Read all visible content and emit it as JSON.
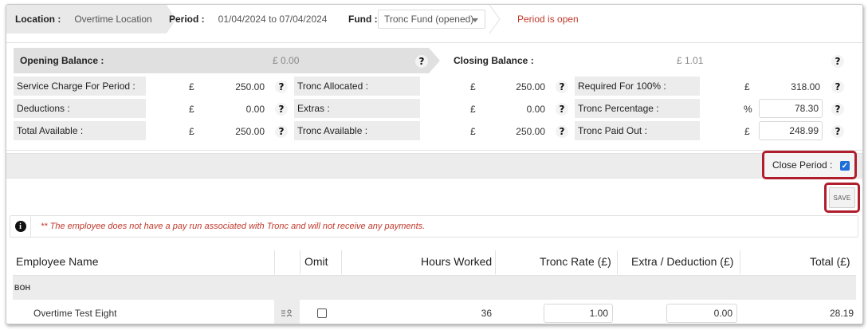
{
  "topbar": {
    "location_label": "Location :",
    "location_value": "Overtime Location",
    "period_label": "Period :",
    "period_value": "01/04/2024 to 07/04/2024",
    "fund_label": "Fund :",
    "fund_value": "Tronc Fund (opened)",
    "status": "Period is open"
  },
  "balances": {
    "opening_label": "Opening Balance :",
    "opening_value": "£ 0.00",
    "closing_label": "Closing Balance :",
    "closing_value": "£ 1.01",
    "help": "?",
    "currency": "£",
    "percent": "%",
    "rows": [
      {
        "c1_label": "Service Charge For Period :",
        "c1_value": "250.00",
        "c2_label": "Tronc Allocated :",
        "c2_value": "250.00",
        "c3_label": "Required For 100% :",
        "c3_value": "318.00"
      },
      {
        "c1_label": "Deductions :",
        "c1_value": "0.00",
        "c2_label": "Extras :",
        "c2_value": "0.00",
        "c3_label": "Tronc Percentage :",
        "c3_value": "78.30"
      },
      {
        "c1_label": "Total Available :",
        "c1_value": "250.00",
        "c2_label": "Tronc Available :",
        "c2_value": "250.00",
        "c3_label": "Tronc Paid Out :",
        "c3_value": "248.99"
      }
    ]
  },
  "close_period": {
    "label": "Close Period :",
    "checked": true
  },
  "save_label": "SAVE",
  "info": {
    "icon": "i",
    "message": "** The employee does not have a pay run associated with Tronc and will not receive any payments."
  },
  "table": {
    "headers": {
      "name": "Employee Name",
      "omit": "Omit",
      "hours": "Hours Worked",
      "rate": "Tronc Rate (£)",
      "extra": "Extra / Deduction (£)",
      "total": "Total (£)"
    },
    "group": "BOH",
    "rows": [
      {
        "name": "Overtime Test Eight",
        "hours": "36",
        "rate": "1.00",
        "extra": "0.00",
        "total": "28.19",
        "omit": false
      }
    ]
  },
  "colors": {
    "accent_red": "#b01e2e",
    "status_red": "#c0392b",
    "check_blue": "#1e6fd9"
  }
}
